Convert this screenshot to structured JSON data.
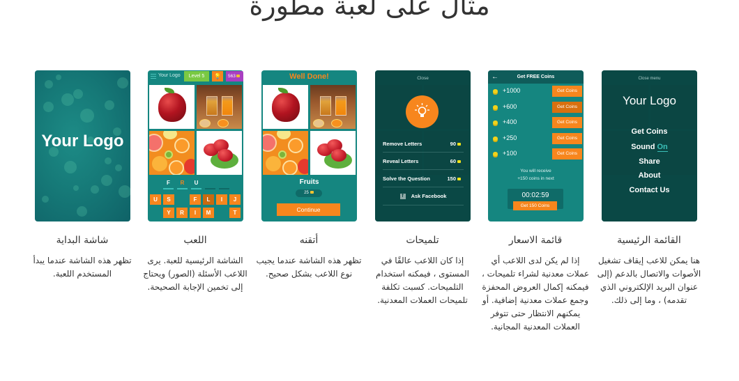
{
  "page": {
    "title": "مثال على لعبة مطورة"
  },
  "screens": [
    {
      "id": "splash",
      "caption": "شاشة البداية",
      "description": "تظهر هذه الشاشة عندما يبدأ المستخدم اللعبة.",
      "logo_text": "Your Logo"
    },
    {
      "id": "gameplay",
      "caption": "اللعب",
      "description": "الشاشة الرئيسية للعبة. يرى اللاعب الأسئلة (الصور) ويحتاج إلى تخمين الإجابة الصحيحة.",
      "topbar": {
        "logo_text": "Your Logo",
        "level_label": "Level 5",
        "hint_icon": "lightbulb-icon",
        "coins": "563"
      },
      "answer_slots": [
        "F",
        "R",
        "U",
        "",
        ""
      ],
      "keyboard_row1": [
        "U",
        "S",
        "",
        "F",
        "L",
        "I",
        "J"
      ],
      "keyboard_row2": [
        "",
        "Y",
        "R",
        "I",
        "M",
        "",
        "T"
      ],
      "pictures": [
        "apple",
        "juice",
        "citrus",
        "strawberries"
      ]
    },
    {
      "id": "well-done",
      "caption": "أتقنه",
      "description": "تظهر هذه الشاشة عندما يجيب نوع اللاعب بشكل صحيح.",
      "title": "Well Done!",
      "word": "Fruits",
      "reward": "25",
      "continue_label": "Continue"
    },
    {
      "id": "hints",
      "caption": "تلميحات",
      "description": "إذا كان اللاعب عالقًا في المستوى ، فيمكنه استخدام التلميحات. كسبت تكلفة تلميحات العملات المعدنية.",
      "close_label": "Close",
      "hints": [
        {
          "name": "Remove Letters",
          "price": "90"
        },
        {
          "name": "Reveal Letters",
          "price": "60"
        },
        {
          "name": "Solve the Question",
          "price": "150"
        }
      ],
      "facebook_label": "Ask Facebook"
    },
    {
      "id": "coins-store",
      "caption": "قائمة الاسعار",
      "description": "إذا لم يكن لدى اللاعب أي عملات معدنية لشراء تلميحات ، فيمكنه إكمال العروض المحفزة وجمع عملات معدنية إضافية. أو يمكنهم الانتظار حتى تتوفر العملات المعدنية المجانية.",
      "header": "Get FREE Coins",
      "offers": [
        {
          "amount": "+1000",
          "button": "Get Coins"
        },
        {
          "amount": "+600",
          "button": "Get Coins"
        },
        {
          "amount": "+400",
          "button": "Get Coins"
        },
        {
          "amount": "+250",
          "button": "Get Coins"
        },
        {
          "amount": "+100",
          "button": "Get Coins"
        }
      ],
      "receive_line1": "You will receive",
      "receive_line2": "+150 coins in next",
      "timer": "00:02:59",
      "timer_button": "Get 150 Coins"
    },
    {
      "id": "main-menu",
      "caption": "القائمة الرئيسية",
      "description": "هنا يمكن للاعب إيقاف تشغيل الأصوات والاتصال بالدعم (إلى عنوان البريد الإلكتروني الذي تقدمه) ، وما إلى ذلك.",
      "close_label": "Close menu",
      "logo_text": "Your Logo",
      "items": [
        "Get Coins",
        "Sound",
        "Share",
        "About",
        "Contact Us"
      ],
      "sound_state": "On"
    }
  ],
  "colors": {
    "teal": "#158680",
    "dark_teal": "#0f5c5a",
    "orange": "#f7861d",
    "green": "#7ac943",
    "purple": "#a93fc1",
    "accent": "#3bc0b9"
  }
}
